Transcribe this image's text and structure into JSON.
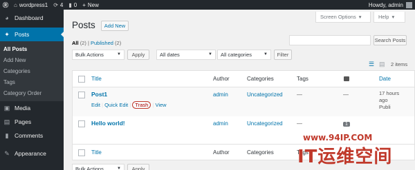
{
  "adminbar": {
    "site_name": "wordpress1",
    "updates_count": "4",
    "comments_count": "0",
    "new_label": "New",
    "howdy": "Howdy, admin"
  },
  "sidebar": {
    "dashboard": "Dashboard",
    "posts": "Posts",
    "submenu": [
      "All Posts",
      "Add New",
      "Categories",
      "Tags",
      "Category Order"
    ],
    "media": "Media",
    "pages": "Pages",
    "comments": "Comments",
    "appearance": "Appearance"
  },
  "header": {
    "screen_options": "Screen Options",
    "help": "Help",
    "title": "Posts",
    "add_new": "Add New"
  },
  "filters": {
    "all_label": "All",
    "all_count": "(2)",
    "separator": "|",
    "published_label": "Published",
    "published_count": "(2)",
    "search_button": "Search Posts",
    "bulk_actions": "Bulk Actions",
    "apply": "Apply",
    "all_dates": "All dates",
    "all_categories": "All categories",
    "filter": "Filter",
    "items_count": "2 items"
  },
  "table": {
    "columns": {
      "title": "Title",
      "author": "Author",
      "categories": "Categories",
      "tags": "Tags",
      "date": "Date"
    },
    "rows": [
      {
        "title": "Post1",
        "author": "admin",
        "category": "Uncategorized",
        "tags": "—",
        "comments": "—",
        "date_line1": "17 hours",
        "date_line2": "ago",
        "date_line3": "Publi",
        "actions": {
          "edit": "Edit",
          "quick_edit": "Quick Edit",
          "trash": "Trash",
          "view": "View",
          "sep": "|"
        }
      },
      {
        "title": "Hello world!",
        "author": "admin",
        "category": "Uncategorized",
        "tags": "—",
        "comments": "1"
      }
    ]
  },
  "watermark": {
    "url": "www.94IP.COM",
    "name": "IT运维空间"
  },
  "colors": {
    "adminbar": "#23282d",
    "accent": "#0073aa",
    "trash_highlight": "#c0392b"
  }
}
